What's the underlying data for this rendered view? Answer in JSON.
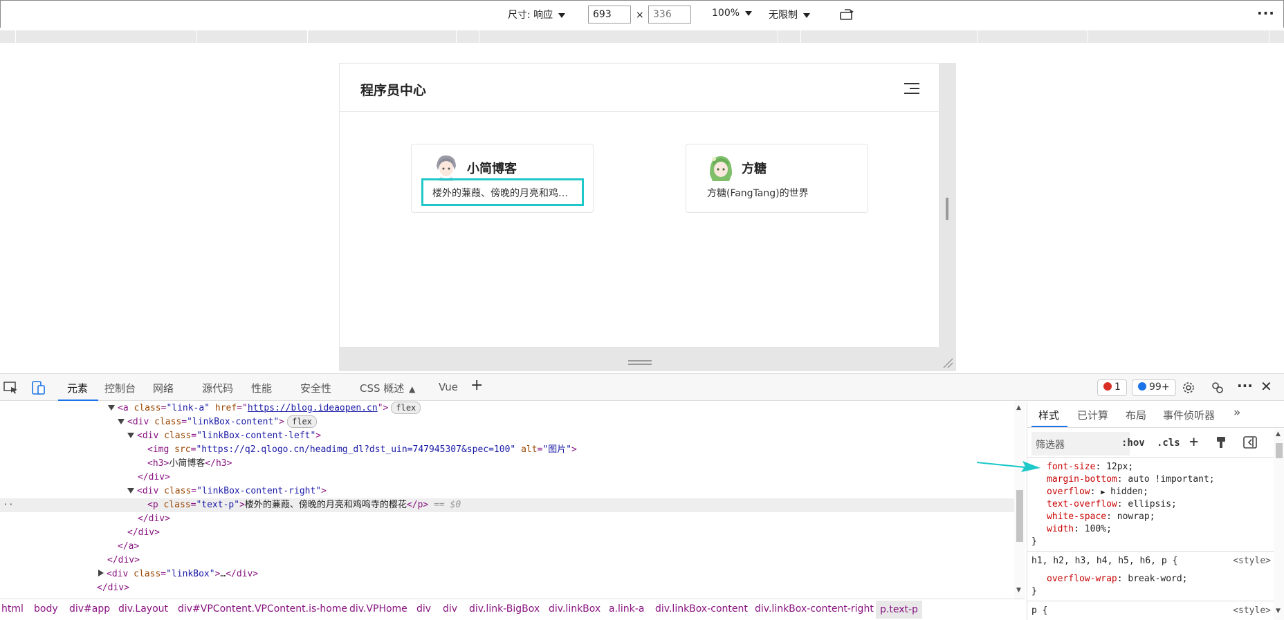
{
  "device_toolbar": {
    "dimensions_label": "尺寸: 响应",
    "width_value": "693",
    "height_placeholder": "336",
    "times": "×",
    "zoom": "100%",
    "throttle": "无限制",
    "more": "⋮"
  },
  "page": {
    "title": "程序员中心",
    "cards": [
      {
        "name": "小简博客",
        "desc": "楼外的蒹葭、傍晚的月亮和鸡鸣寺的樱花"
      },
      {
        "name": "方糖",
        "desc": "方糖(FangTang)的世界"
      }
    ]
  },
  "devtools": {
    "tabs": [
      "元素",
      "控制台",
      "网络",
      "源代码",
      "性能",
      "安全性",
      "CSS 概述",
      "Vue"
    ],
    "error_count": "1",
    "message_count": "99+",
    "elements": {
      "l1": {
        "tag": "a",
        "class_val": "\"link-a\"",
        "href_val": "https://blog.ideaopen.cn",
        "pill": "flex"
      },
      "l2": {
        "class_val": "\"linkBox-content\"",
        "pill": "flex"
      },
      "l3": {
        "class_val": "\"linkBox-content-left\""
      },
      "l4": {
        "src_val": "\"https://q2.qlogo.cn/headimg_dl?dst_uin=747945307&spec=100\"",
        "alt_val": "\"图片\""
      },
      "l5": {
        "text": "小简博客"
      },
      "l7": {
        "class_val": "\"linkBox-content-right\""
      },
      "l8": {
        "class_val": "\"text-p\"",
        "text": "楼外的蒹葭、傍晚的月亮和鸡鸣寺的樱花",
        "marker": "== $0"
      },
      "l13": {
        "class_val": "\"linkBox\"",
        "ellipsis": "…"
      }
    },
    "breadcrumbs": [
      "html",
      "body",
      "div#app",
      "div.Layout",
      "div#VPContent.VPContent.is-home",
      "div.VPHome",
      "div",
      "div",
      "div.link-BigBox",
      "div.linkBox",
      "a.link-a",
      "div.linkBox-content",
      "div.linkBox-content-right",
      "p.text-p"
    ],
    "styles": {
      "tabs": [
        "样式",
        "已计算",
        "布局",
        "事件侦听器"
      ],
      "filter_placeholder": "筛选器",
      "hov": ":hov",
      "cls": ".cls",
      "rules": [
        {
          "prop": "font-size",
          "value": "12px;"
        },
        {
          "prop": "margin-bottom",
          "value": "auto !important;"
        },
        {
          "prop": "overflow",
          "value": "hidden;"
        },
        {
          "prop": "text-overflow",
          "value": "ellipsis;"
        },
        {
          "prop": "white-space",
          "value": "nowrap;"
        },
        {
          "prop": "width",
          "value": "100%;"
        }
      ],
      "close_brace": "}",
      "selector2": "h1, h2, h3, h4, h5, h6, p {",
      "source2": "<style>",
      "rule2_prop": "overflow-wrap",
      "rule2_value": "break-word;",
      "selector3": "p {",
      "source3": "<style>"
    }
  }
}
